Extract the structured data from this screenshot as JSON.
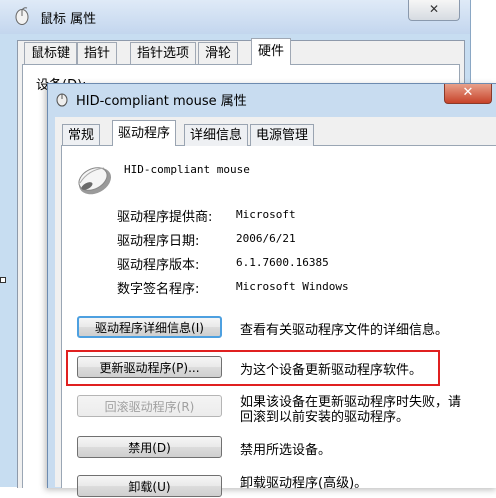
{
  "background_window": {
    "title": "鼠标 属性",
    "close_label": "✕",
    "tabs": [
      "鼠标键",
      "指针",
      "指针选项",
      "滑轮",
      "硬件"
    ],
    "active_tab": "硬件",
    "devices_label": "设备(D):"
  },
  "dialog": {
    "title": "HID-compliant mouse 属性",
    "close_label": "✕",
    "tabs": [
      "常规",
      "驱动程序",
      "详细信息",
      "电源管理"
    ],
    "active_tab": "驱动程序",
    "device_name": "HID-compliant mouse",
    "info": [
      {
        "label": "驱动程序提供商:",
        "value": "Microsoft"
      },
      {
        "label": "驱动程序日期:",
        "value": "2006/6/21"
      },
      {
        "label": "驱动程序版本:",
        "value": "6.1.7600.16385"
      },
      {
        "label": "数字签名程序:",
        "value": "Microsoft Windows"
      }
    ],
    "actions": [
      {
        "button": "驱动程序详细信息(I)",
        "description": "查看有关驱动程序文件的详细信息。",
        "enabled": true
      },
      {
        "button": "更新驱动程序(P)...",
        "description": "为这个设备更新驱动程序软件。",
        "enabled": true,
        "highlighted": true
      },
      {
        "button": "回滚驱动程序(R)",
        "description_line1": "如果该设备在更新驱动程序时失败，请",
        "description_line2": "回滚到以前安装的驱动程序。",
        "enabled": false
      },
      {
        "button": "禁用(D)",
        "description": "禁用所选设备。",
        "enabled": true
      },
      {
        "button": "卸载(U)",
        "description": "卸载驱动程序(高级)。",
        "enabled": true
      }
    ]
  },
  "colors": {
    "highlight_border": "#e02020",
    "window_frame": "#c8dcf0"
  }
}
